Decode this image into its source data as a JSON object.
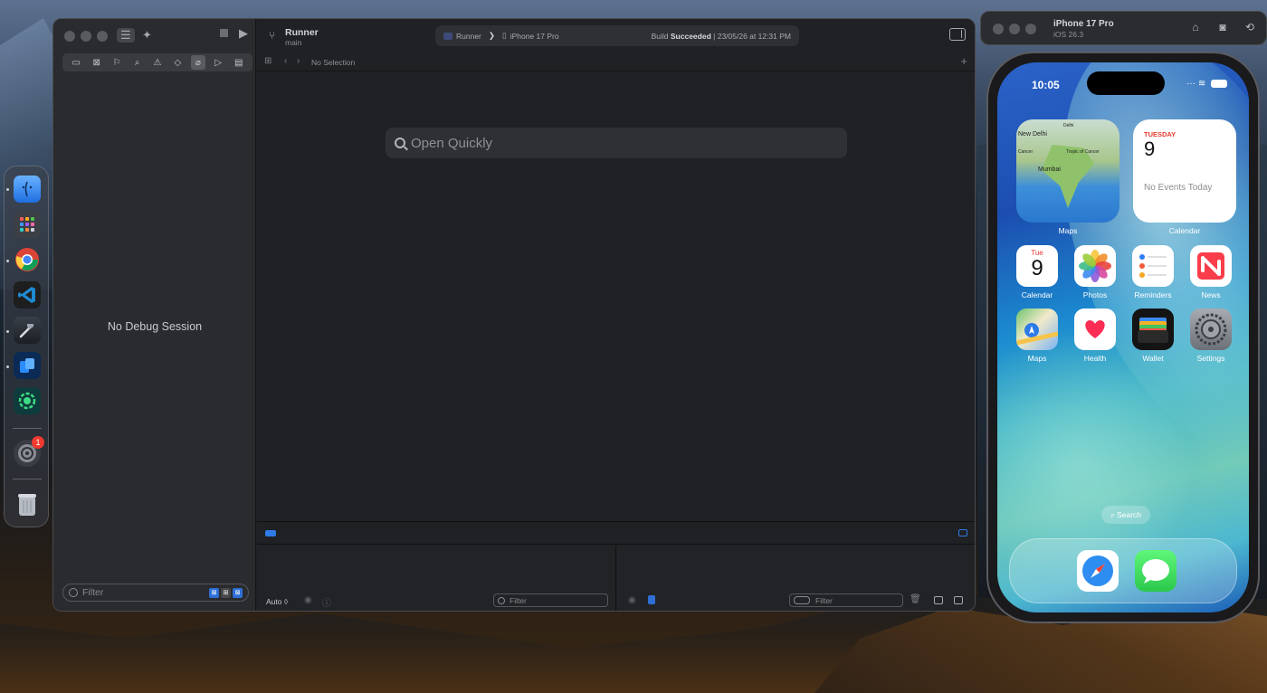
{
  "dock": {
    "items": [
      {
        "name": "finder-icon",
        "color": "#2a7ae8"
      },
      {
        "name": "launchpad-icon",
        "color": "#4b4f57"
      },
      {
        "name": "chrome-icon",
        "color": "#ffffff"
      },
      {
        "name": "vscode-icon",
        "color": "#1f6fc1"
      },
      {
        "name": "xcode-icon",
        "color": "#3a3f48"
      },
      {
        "name": "simulator-icon",
        "color": "#2a7ae8"
      },
      {
        "name": "android-studio-icon",
        "color": "#0e3b3b"
      },
      {
        "name": "system-settings-icon",
        "color": "#8a8d93"
      },
      {
        "name": "trash-icon",
        "color": "#9ea3ab"
      }
    ],
    "settings_badge": "1"
  },
  "xcode": {
    "project": "Runner",
    "branch": "main",
    "scheme": "Runner",
    "device": "iPhone 17 Pro",
    "status_prefix": "Build",
    "status_bold": "Succeeded",
    "status_suffix": "| 23/05/26 at 12:31 PM",
    "no_selection": "No Selection",
    "open_quickly_placeholder": "Open Quickly",
    "no_debug_session": "No Debug Session",
    "navigator_filter_placeholder": "Filter",
    "variables_mode": "Auto ◊",
    "variables_filter_placeholder": "Filter",
    "console_filter_placeholder": "Filter"
  },
  "simulator": {
    "title": "iPhone 17 Pro",
    "subtitle": "iOS 26.3",
    "time": "10:05",
    "widgets": {
      "maps": {
        "label": "Maps",
        "places": [
          "Delhi",
          "New Delhi",
          "Cancer",
          "Mumbai",
          "Tropic of Cancer"
        ]
      },
      "calendar": {
        "day": "TUESDAY",
        "date": "9",
        "events": "No Events Today",
        "label": "Calendar"
      }
    },
    "apps": [
      {
        "label": "Calendar",
        "icon": "calendar-icon",
        "day": "Tue",
        "date": "9"
      },
      {
        "label": "Photos",
        "icon": "photos-icon"
      },
      {
        "label": "Reminders",
        "icon": "reminders-icon"
      },
      {
        "label": "News",
        "icon": "news-icon"
      },
      {
        "label": "Maps",
        "icon": "maps-icon"
      },
      {
        "label": "Health",
        "icon": "health-icon"
      },
      {
        "label": "Wallet",
        "icon": "wallet-icon"
      },
      {
        "label": "Settings",
        "icon": "settings-icon"
      }
    ],
    "search_label": "Search",
    "dock_apps": [
      "safari-icon",
      "messages-icon"
    ]
  }
}
